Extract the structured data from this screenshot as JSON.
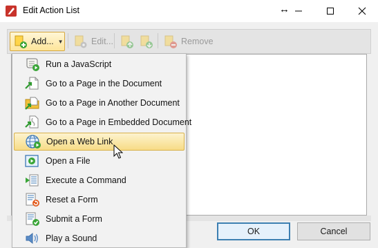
{
  "window": {
    "title": "Edit Action List",
    "resize_glyph": "↔",
    "controls": [
      "minimize-icon",
      "maximize-icon",
      "close-icon"
    ]
  },
  "toolbar": {
    "add_label": "Add...",
    "edit_label": "Edit...",
    "remove_label": "Remove"
  },
  "menu": {
    "items": [
      {
        "label": "Run a JavaScript",
        "icon": "javascript-scroll-icon"
      },
      {
        "label": "Go to a Page in the Document",
        "icon": "goto-page-icon"
      },
      {
        "label": "Go to a Page in Another Document",
        "icon": "goto-other-document-icon"
      },
      {
        "label": "Go to a Page in Embedded Document",
        "icon": "goto-embedded-document-icon"
      },
      {
        "label": "Open a Web Link",
        "icon": "web-link-icon"
      },
      {
        "label": "Open a File",
        "icon": "open-file-icon"
      },
      {
        "label": "Execute a Command",
        "icon": "execute-command-icon"
      },
      {
        "label": "Reset a Form",
        "icon": "reset-form-icon"
      },
      {
        "label": "Submit a Form",
        "icon": "submit-form-icon"
      },
      {
        "label": "Play a Sound",
        "icon": "play-sound-icon"
      }
    ],
    "highlighted_index": 4
  },
  "buttons": {
    "ok_label": "OK",
    "cancel_label": "Cancel"
  },
  "colors": {
    "accent_border": "#3c7fb1",
    "highlight": "#f7dc86",
    "brand_red": "#c8332b"
  }
}
